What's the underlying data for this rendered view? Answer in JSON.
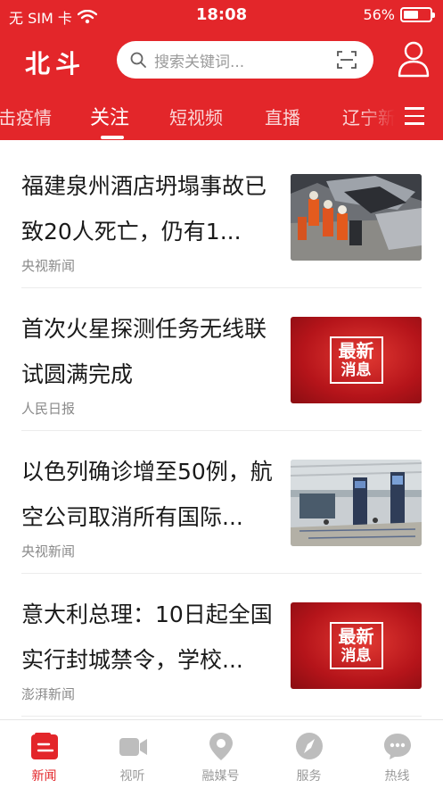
{
  "status_bar": {
    "carrier": "无 SIM 卡",
    "time": "18:08",
    "battery": "56%",
    "battery_level": 0.56
  },
  "header": {
    "logo": "北斗",
    "search_placeholder": "搜索关键词...",
    "accent_color": "#e3262a"
  },
  "channels": [
    {
      "label": "击疫情",
      "active": false
    },
    {
      "label": "关注",
      "active": true
    },
    {
      "label": "短视频",
      "active": false
    },
    {
      "label": "直播",
      "active": false
    },
    {
      "label": "辽宁新",
      "active": false
    }
  ],
  "feed": [
    {
      "title": "福建泉州酒店坍塌事故已致20人死亡，仍有1...",
      "source": "央视新闻",
      "thumb": "collapse-rescue-photo"
    },
    {
      "title": "首次火星探测任务无线联试圆满完成",
      "source": "人民日报",
      "thumb": "breaking-news-graphic",
      "thumb_text": [
        "最新",
        "消息"
      ]
    },
    {
      "title": "以色列确诊增至50例，航空公司取消所有国际...",
      "source": "央视新闻",
      "thumb": "airport-terminal-photo"
    },
    {
      "title": "意大利总理：10日起全国实行封城禁令，学校...",
      "source": "澎湃新闻",
      "thumb": "breaking-news-graphic",
      "thumb_text": [
        "最新",
        "消息"
      ]
    }
  ],
  "tabbar": [
    {
      "label": "新闻",
      "icon": "news-icon",
      "active": true
    },
    {
      "label": "视听",
      "icon": "video-camera-icon",
      "active": false
    },
    {
      "label": "融媒号",
      "icon": "location-pin-icon",
      "active": false
    },
    {
      "label": "服务",
      "icon": "compass-icon",
      "active": false
    },
    {
      "label": "热线",
      "icon": "chat-bubble-icon",
      "active": false
    }
  ]
}
